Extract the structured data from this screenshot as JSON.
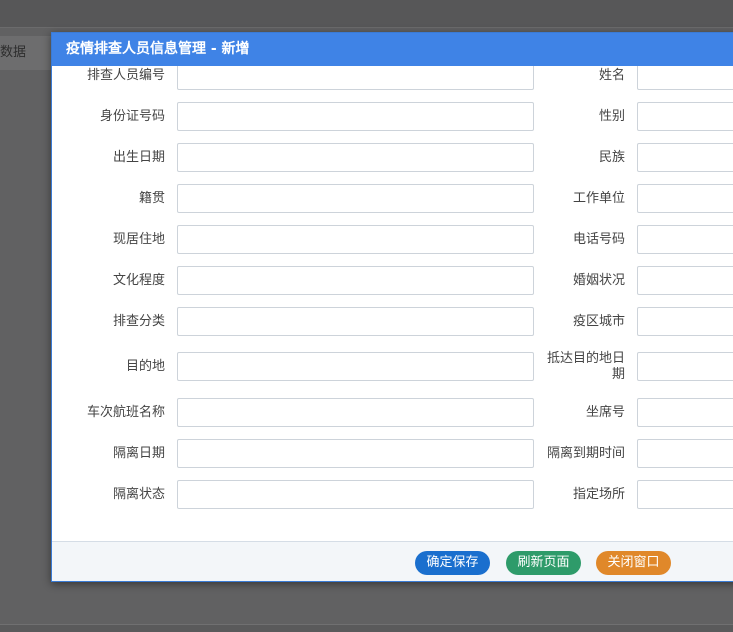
{
  "background": {
    "tab_label": "数据"
  },
  "dialog": {
    "title": "疫情排查人员信息管理 - 新增"
  },
  "form": {
    "rows": [
      {
        "left_label": "排查人员编号",
        "left_value": "",
        "right_label": "姓名",
        "right_value": ""
      },
      {
        "left_label": "身份证号码",
        "left_value": "",
        "right_label": "性别",
        "right_value": ""
      },
      {
        "left_label": "出生日期",
        "left_value": "",
        "right_label": "民族",
        "right_value": ""
      },
      {
        "left_label": "籍贯",
        "left_value": "",
        "right_label": "工作单位",
        "right_value": ""
      },
      {
        "left_label": "现居住地",
        "left_value": "",
        "right_label": "电话号码",
        "right_value": ""
      },
      {
        "left_label": "文化程度",
        "left_value": "",
        "right_label": "婚姻状况",
        "right_value": ""
      },
      {
        "left_label": "排查分类",
        "left_value": "",
        "right_label": "疫区城市",
        "right_value": ""
      },
      {
        "left_label": "目的地",
        "left_value": "",
        "right_label": "抵达目的地日期",
        "right_value": ""
      },
      {
        "left_label": "车次航班名称",
        "left_value": "",
        "right_label": "坐席号",
        "right_value": ""
      },
      {
        "left_label": "隔离日期",
        "left_value": "",
        "right_label": "隔离到期时间",
        "right_value": ""
      },
      {
        "left_label": "隔离状态",
        "left_value": "",
        "right_label": "指定场所",
        "right_value": ""
      }
    ]
  },
  "footer": {
    "save_label": "确定保存",
    "refresh_label": "刷新页面",
    "close_label": "关闭窗口"
  },
  "colors": {
    "header": "#3f83e6",
    "save": "#1a6fce",
    "refresh": "#2e9b6a",
    "close": "#e0882a"
  }
}
